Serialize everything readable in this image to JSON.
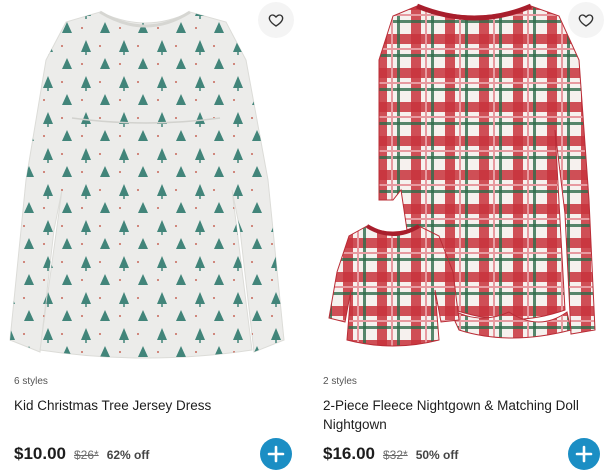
{
  "products": [
    {
      "styles_count": "6 styles",
      "name": "Kid Christmas Tree Jersey Dress",
      "price": "$10.00",
      "original_price": "$26*",
      "discount": "62% off",
      "image_icon": "gray-tree-print-dress-image",
      "favorite_icon": "heart-outline-icon",
      "add_icon": "plus-icon"
    },
    {
      "styles_count": "2 styles",
      "name": "2-Piece Fleece Nightgown & Matching Doll Nightgown",
      "price": "$16.00",
      "original_price": "$32*",
      "discount": "50% off",
      "image_icon": "red-plaid-nightgown-image",
      "favorite_icon": "heart-outline-icon",
      "add_icon": "plus-icon"
    }
  ],
  "colors": {
    "accent": "#1b8ec4",
    "plaid_red": "#c8323c",
    "plaid_green": "#2e6b4a",
    "dress_gray": "#ececea",
    "tree_green": "#2f7a6e"
  }
}
